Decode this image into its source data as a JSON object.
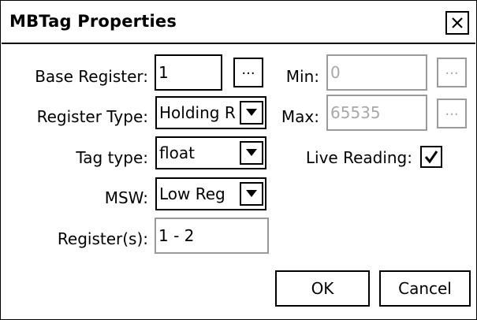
{
  "dialog": {
    "title": "MBTag Properties",
    "close_icon": "close-icon"
  },
  "fields": {
    "base_register": {
      "label": "Base Register:",
      "value": "1",
      "browse_label": "..."
    },
    "register_type": {
      "label": "Register Type:",
      "value": "Holding R"
    },
    "tag_type": {
      "label": "Tag type:",
      "value": "float"
    },
    "msw": {
      "label": "MSW:",
      "value": "Low Reg"
    },
    "registers": {
      "label": "Register(s):",
      "value": "1 - 2"
    },
    "min": {
      "label": "Min:",
      "value": "0",
      "browse_label": "..."
    },
    "max": {
      "label": "Max:",
      "value": "65535",
      "browse_label": "..."
    },
    "live_reading": {
      "label": "Live Reading:",
      "checked": true
    }
  },
  "buttons": {
    "ok": "OK",
    "cancel": "Cancel"
  },
  "colors": {
    "border": "#000000",
    "disabled": "#a8a8a8",
    "background": "#ffffff"
  }
}
